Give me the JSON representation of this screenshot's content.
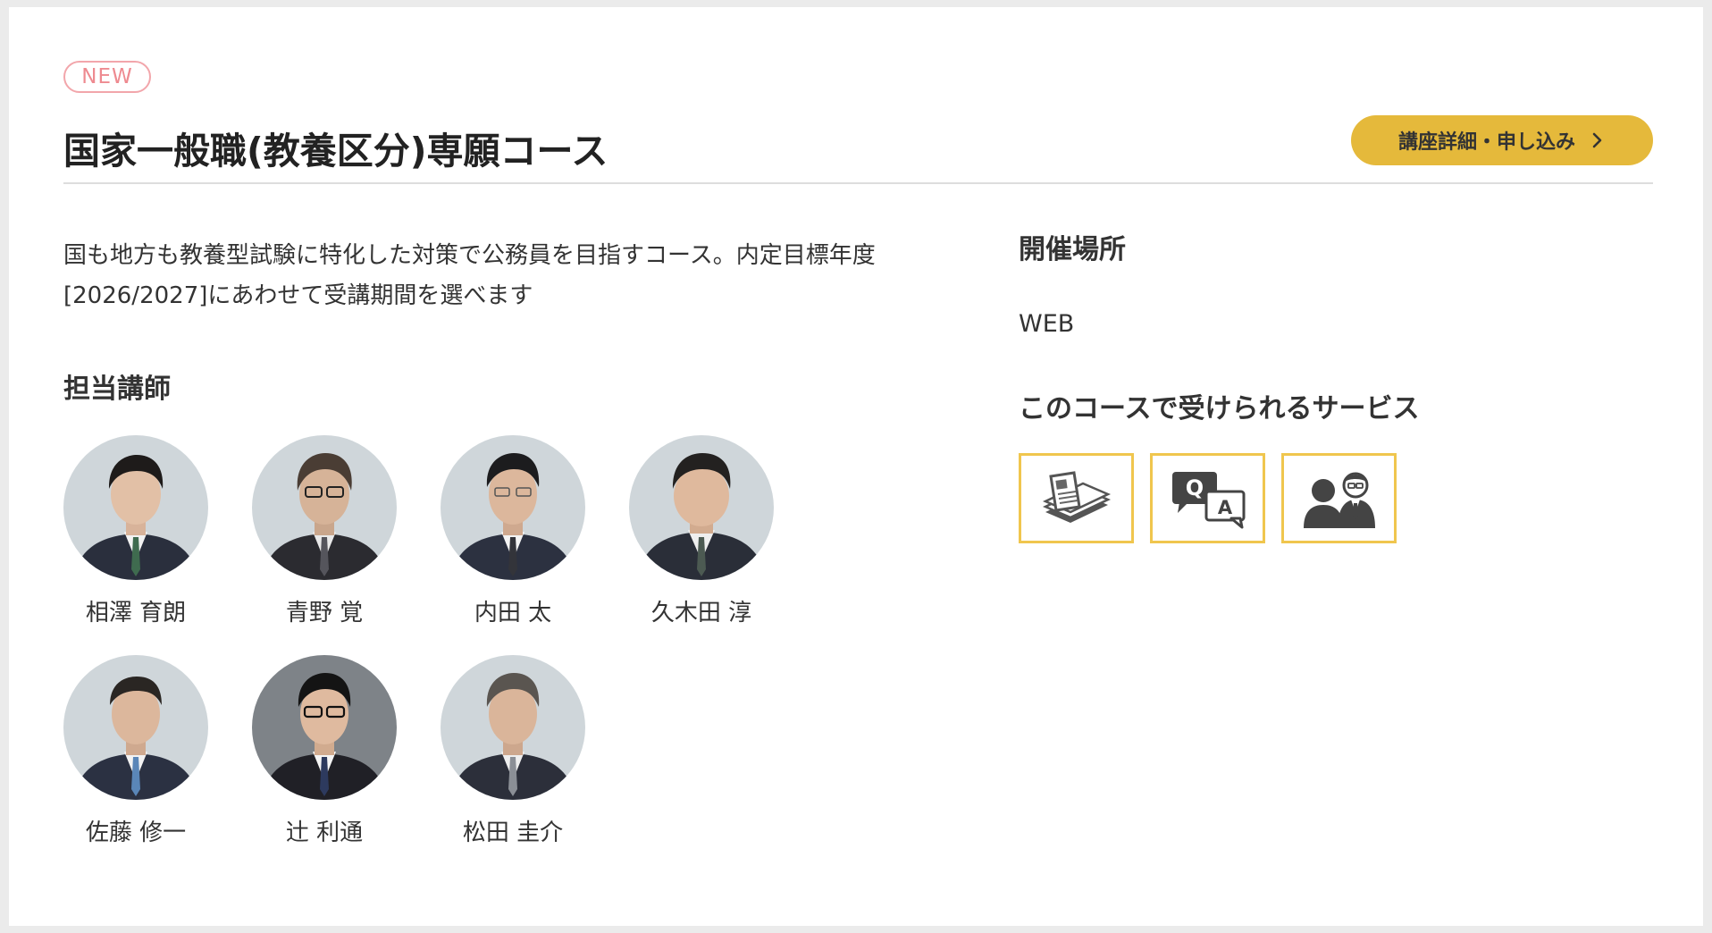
{
  "badge": "NEW",
  "course_title": "国家一般職(教養区分)専願コース",
  "cta_label": "講座詳細・申し込み",
  "description": "国も地方も教養型試験に特化した対策で公務員を目指すコース。内定目標年度[2026/2027]にあわせて受講期間を選べます",
  "instructors_heading": "担当講師",
  "instructors": [
    {
      "name": "相澤 育朗"
    },
    {
      "name": "青野 覚"
    },
    {
      "name": "内田 太"
    },
    {
      "name": "久木田 淳"
    },
    {
      "name": "佐藤 修一"
    },
    {
      "name": "辻 利通"
    },
    {
      "name": "松田 圭介"
    }
  ],
  "venue_heading": "開催場所",
  "venue": "WEB",
  "services_heading": "このコースで受けられるサービス",
  "services": [
    {
      "icon": "textbook-icon"
    },
    {
      "icon": "qa-chat-icon"
    },
    {
      "icon": "consultation-icon"
    }
  ],
  "colors": {
    "accent": "#e5b93b",
    "badge": "#ee8a90",
    "service_border": "#f0c64e"
  }
}
